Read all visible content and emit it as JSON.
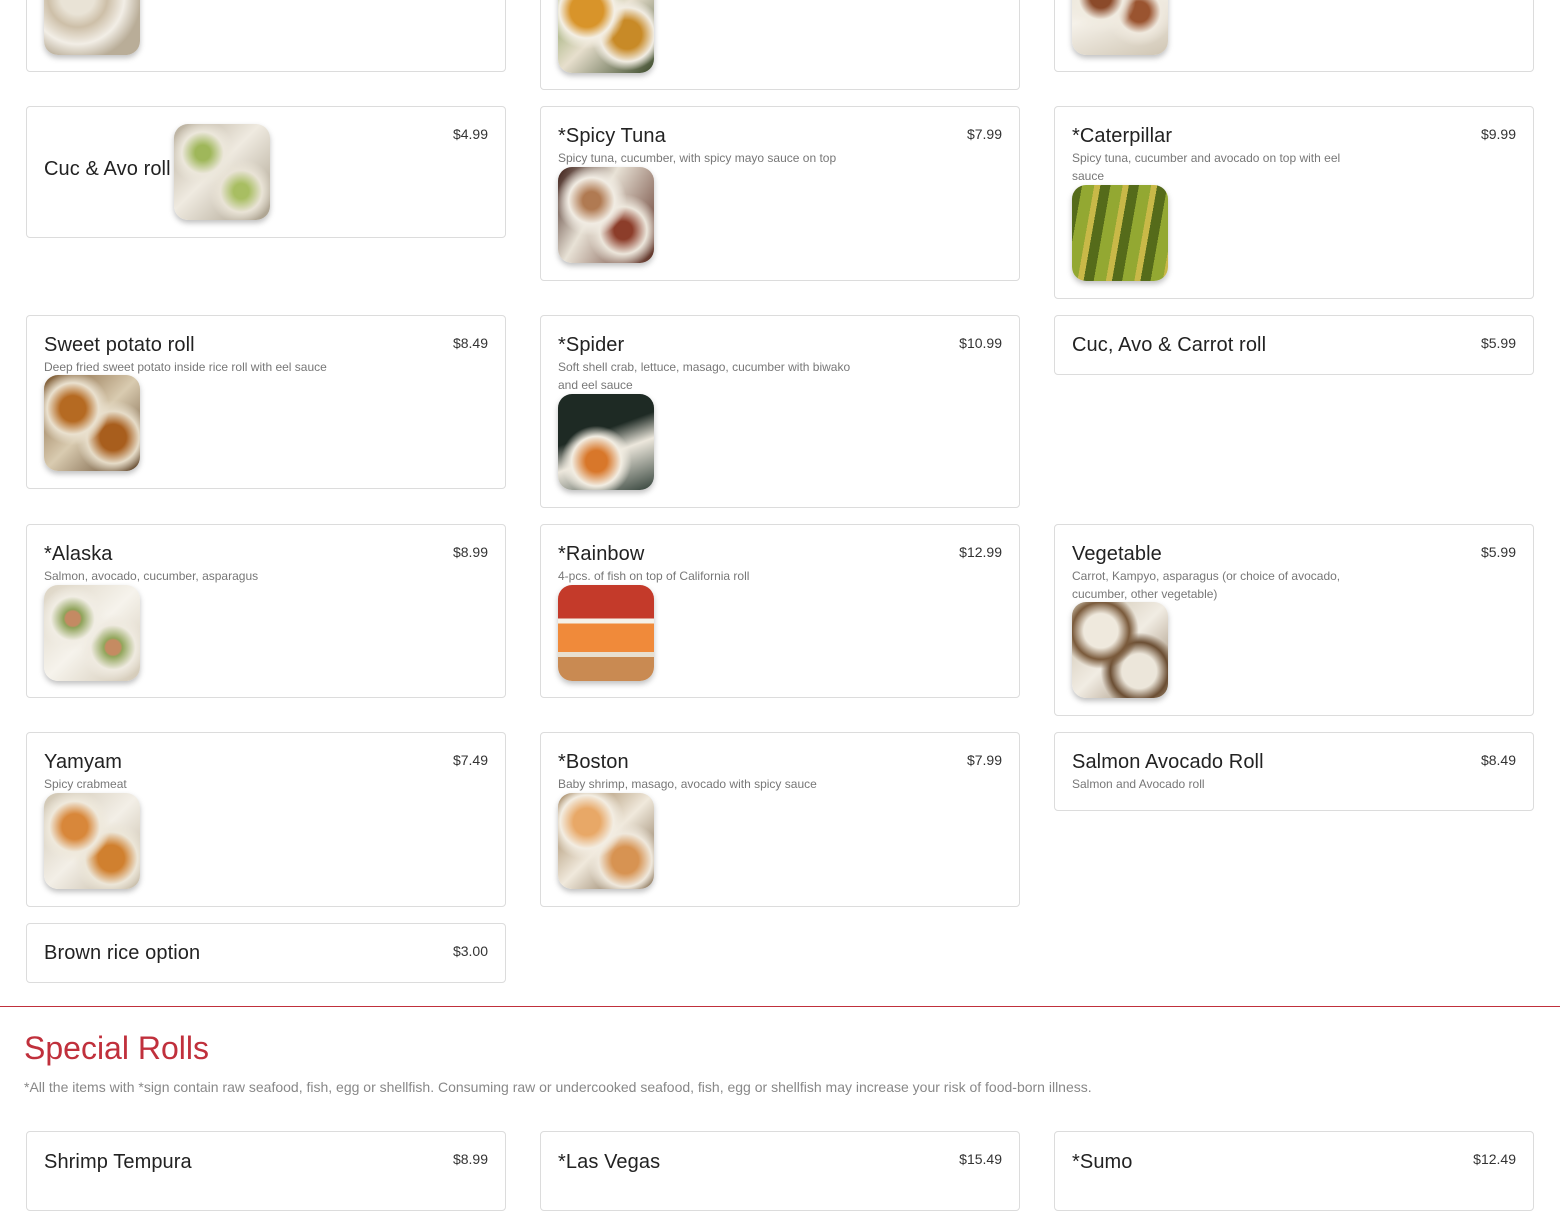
{
  "cards": {
    "california": {},
    "colorful": {},
    "salmon_top": {},
    "cuc_avo": {
      "name": "Cuc & Avo roll",
      "price": "$4.99"
    },
    "spicy_tuna": {
      "name": "*Spicy Tuna",
      "price": "$7.99",
      "desc": "Spicy tuna, cucumber, with spicy mayo sauce on top"
    },
    "caterpillar": {
      "name": "*Caterpillar",
      "price": "$9.99",
      "desc": "Spicy tuna, cucumber and avocado on top with eel sauce"
    },
    "sweet_potato": {
      "name": "Sweet potato roll",
      "price": "$8.49",
      "desc": "Deep fried sweet potato inside rice roll with eel sauce"
    },
    "spider": {
      "name": "*Spider",
      "price": "$10.99",
      "desc": "Soft shell crab, lettuce, masago, cucumber with biwako and eel sauce"
    },
    "cuc_avo_carrot": {
      "name": "Cuc, Avo & Carrot roll",
      "price": "$5.99"
    },
    "alaska": {
      "name": "*Alaska",
      "price": "$8.99",
      "desc": "Salmon, avocado, cucumber, asparagus"
    },
    "rainbow": {
      "name": "*Rainbow",
      "price": "$12.99",
      "desc": "4-pcs. of fish on top of California roll"
    },
    "vegetable": {
      "name": "Vegetable",
      "price": "$5.99",
      "desc": "Carrot, Kampyo, asparagus (or choice of avocado, cucumber, other vegetable)"
    },
    "yamyam": {
      "name": "Yamyam",
      "price": "$7.49",
      "desc": "Spicy crabmeat"
    },
    "boston": {
      "name": "*Boston",
      "price": "$7.99",
      "desc": "Baby shrimp, masago, avocado with spicy sauce"
    },
    "salmon_avocado": {
      "name": "Salmon Avocado Roll",
      "price": "$8.49",
      "desc": "Salmon and Avocado roll"
    },
    "brown_rice": {
      "name": "Brown rice option",
      "price": "$3.00"
    },
    "shrimp_tempura": {
      "name": "Shrimp Tempura",
      "price": "$8.99"
    },
    "las_vegas": {
      "name": "*Las Vegas",
      "price": "$15.49"
    },
    "sumo": {
      "name": "*Sumo",
      "price": "$12.49"
    }
  },
  "section": {
    "title": "Special Rolls",
    "disclaimer": "*All the items with *sign contain raw seafood, fish, egg or shellfish. Consuming raw or undercooked seafood, fish, egg or shellfish may increase your risk of food-born illness."
  },
  "theme": {
    "accent": "#c0303c",
    "border": "#dcdcdc",
    "muted_text": "#777777"
  }
}
